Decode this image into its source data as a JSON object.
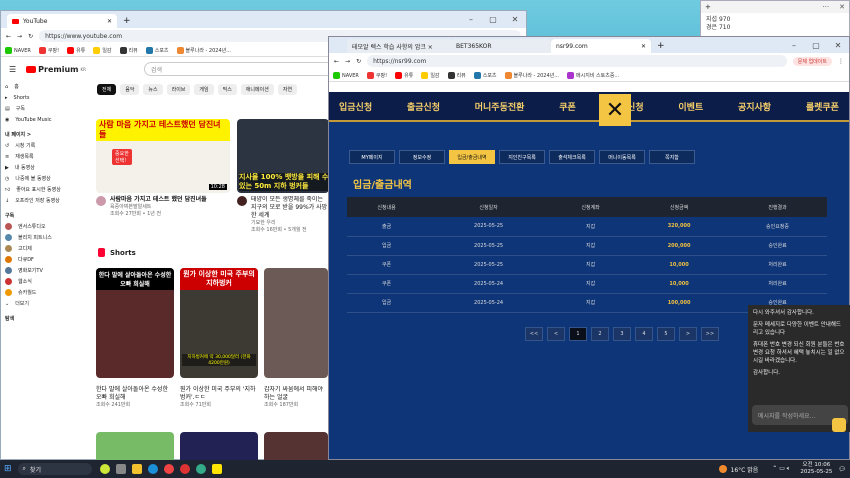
{
  "youtube": {
    "tab_title": "YouTube",
    "url": "https://www.youtube.com",
    "logo": "Premium",
    "logo_suffix": "KR",
    "search_placeholder": "검색",
    "bookmarks": [
      "NAVER",
      "쿠팡!",
      "유튜",
      "일감",
      "",
      "리뷰",
      "스포츠",
      "블루나라 - 2024년...",
      "메시지비 스토츠중..."
    ],
    "sidebar": {
      "main": [
        "홈",
        "Shorts",
        "구독",
        "YouTube Music"
      ],
      "my_header": "내 페이지 >",
      "my": [
        "시청 기록",
        "재생목록",
        "내 동영상",
        "나중에 볼 동영상",
        "좋아요 표시한 동영상",
        "오프라인 저장 동영상"
      ],
      "subs_header": "구독",
      "subs": [
        "엔서스튜디오",
        "블리치 피트니스",
        "고디제",
        "다큐DF",
        "영화보기TV",
        "웹소식",
        "슈카월드"
      ],
      "more": "더보기",
      "explore_header": "탐색"
    },
    "chips": [
      "전체",
      "음악",
      "뉴스",
      "라이브",
      "게임",
      "믹스",
      "애니메이션",
      "자연",
      "요리"
    ],
    "videos": [
      {
        "overlay": "사람 마음 가지고 테스트했던 담진녀들",
        "badge": "중요한\n선택!",
        "duration": "10:28",
        "title": "사람마음 가지고 테스트 했던 담진녀들",
        "channel": "육중아찌본딸알세트",
        "meta": "조회수 27만회 • 1년 전"
      },
      {
        "overlay": "지사율 100% 뱃방을 피해 수 있는 50m 지하 벙커들",
        "duration": "",
        "title": "태양이 모든 생명체를 죽이는 지구의 모로 받을 99%가 사망한 세계",
        "channel": "기묘한 우리",
        "meta": "조회수 16만회 • 5개월 전"
      }
    ],
    "shorts_label": "Shorts",
    "shorts": [
      {
        "overlay": "한다 말에 살아돌아온 수성한 오빠 희실해",
        "title": "한다 말에 살아돌아온 수성한 오빠 희실해",
        "meta": "조회수 241만회"
      },
      {
        "overlay": "뭔가 이상한 미국 주부의 지하벙커",
        "sub": "지하벙커에 약 30,000달러 (한화 4200만원)",
        "title": "뭔가 이상한 미국 주부의 '지하벙커'.ㄷㄷ",
        "meta": "조회수 71만회"
      },
      {
        "overlay": "",
        "title": "갑자기 싸움에서 피해야 하는 얼굴",
        "meta": "조회수 187만회"
      }
    ]
  },
  "lotto": {
    "tabs": [
      "테모알 렉스 학습 사항의 암크 ×",
      "BET365KOR",
      "nsr99.com"
    ],
    "url": "https://nsr99.com",
    "bookmarks": [
      "NAVER",
      "쿠팡!",
      "유튜",
      "일감",
      "",
      "리뷰",
      "스포츠",
      "블루나라 - 2024년...",
      "메시지비 스토츠중..."
    ],
    "update_btn": "문제 업데이트",
    "nav": [
      "입금신청",
      "출금신청",
      "머니주동전환",
      "쿠폰",
      "콤프신청",
      "이벤트",
      "공지사항",
      "룰렛쿠폰"
    ],
    "subtabs": [
      "MY페이지",
      "정보수정",
      "입금/출금내역",
      "지인친구목록",
      "출석체크목록",
      "머니이동목록",
      "쪽지함"
    ],
    "active_subtab": 2,
    "section_title": "입금/출금내역",
    "columns": [
      "신청내용",
      "신청일자",
      "신청계좌",
      "신청금액",
      "진행결과"
    ],
    "rows": [
      [
        "출금",
        "2025-05-25",
        "지갑",
        "320,000",
        "승인요청중"
      ],
      [
        "입금",
        "2025-05-25",
        "지갑",
        "200,000",
        "승인완료"
      ],
      [
        "쿠폰",
        "2025-05-25",
        "지갑",
        "10,000",
        "처리완료"
      ],
      [
        "쿠폰",
        "2025-05-24",
        "지갑",
        "10,000",
        "처리완료"
      ],
      [
        "입금",
        "2025-05-24",
        "지갑",
        "100,000",
        "승인완료"
      ]
    ],
    "pages": [
      "<<",
      "<",
      "1",
      "2",
      "3",
      "4",
      "5",
      ">",
      ">>"
    ],
    "active_page": 2,
    "chat": {
      "lines": [
        "다시 와주셔서 감사합니다.",
        "문자 메세지로 다양한 이벤트 안내해드리고 있습니다",
        "휴대폰 번호 변경 되신 회원 분들은 번호 변경 요청 하셔서 혜택 놓치시는 일 없으시길 바라겠습니다.",
        "감사합니다."
      ],
      "placeholder": "메시지를 작성하세요..."
    }
  },
  "notepad": {
    "lines": [
      "지섭 970",
      "경은 710"
    ]
  },
  "taskbar": {
    "search": "찾기",
    "weather": "16°C 맑음",
    "time": "오전 10:06",
    "date": "2025-05-25"
  }
}
